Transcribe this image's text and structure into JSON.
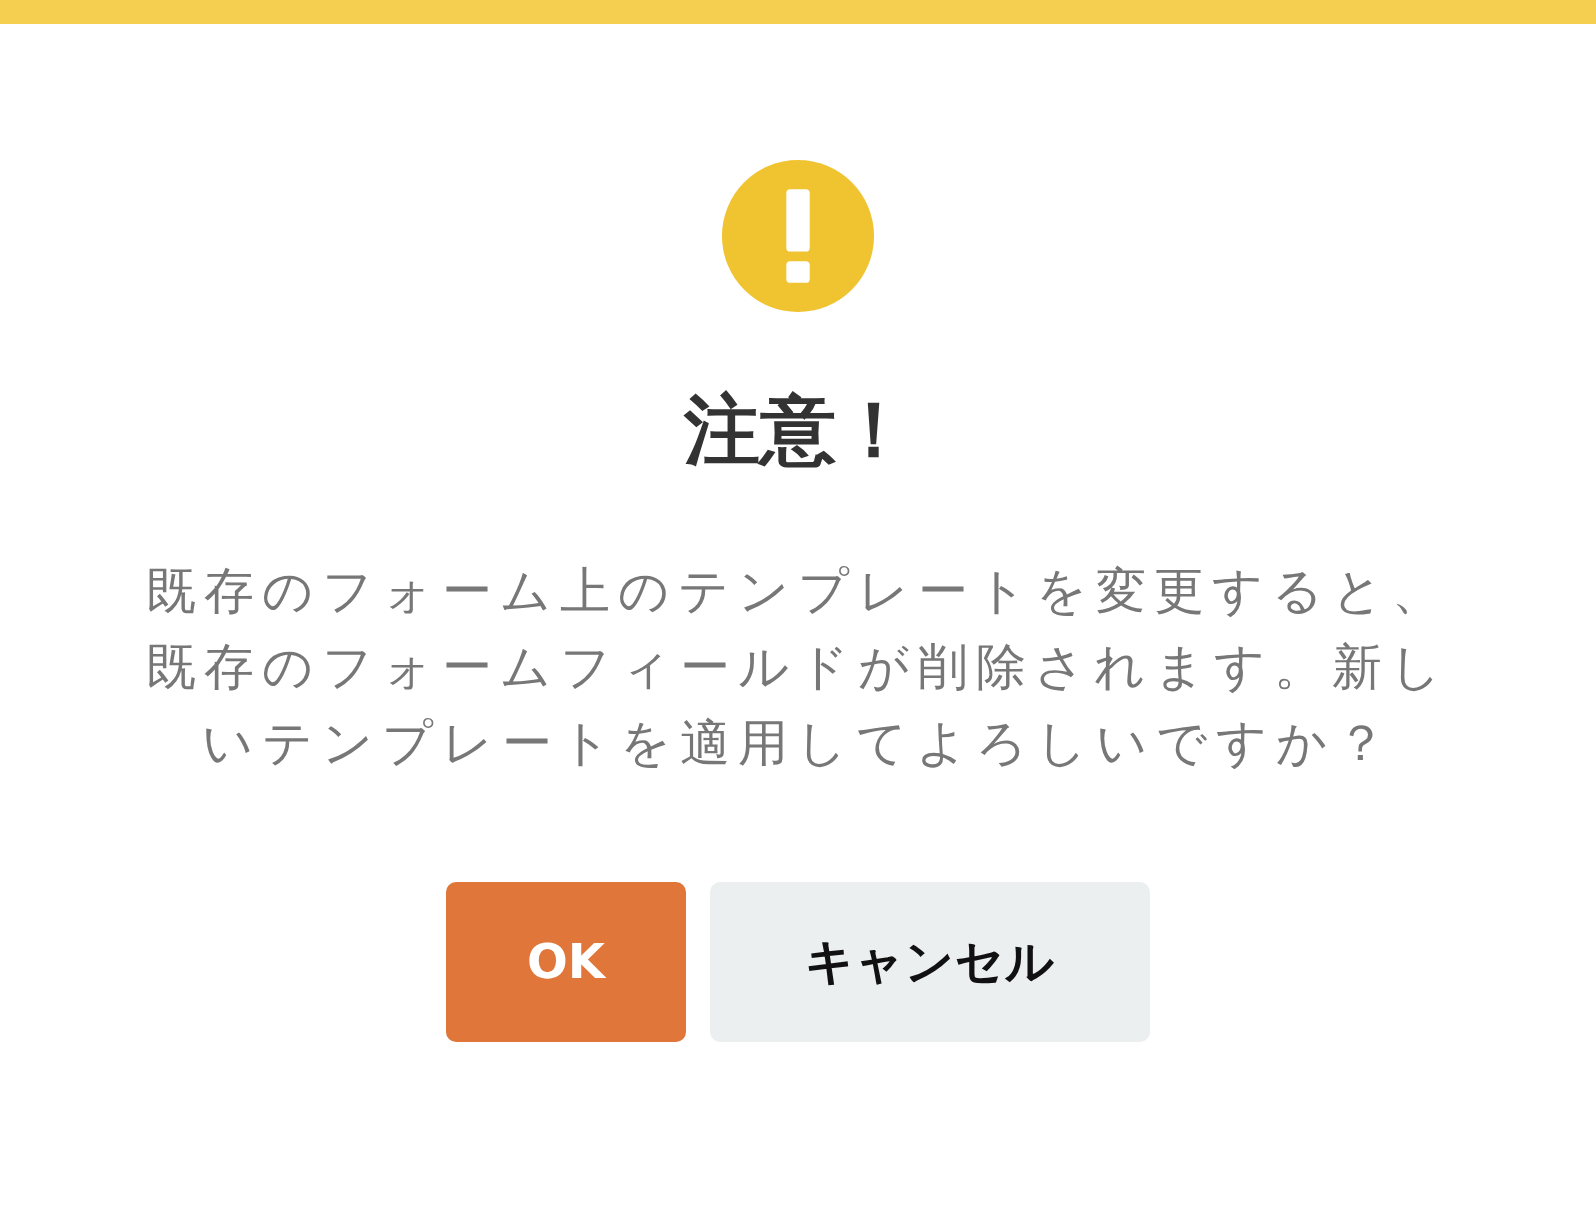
{
  "dialog": {
    "icon": {
      "kind": "warning"
    },
    "title": "注意！",
    "message": "既存のフォーム上のテンプレートを変更すると、既存のフォームフィールドが削除されます。新しいテンプレートを適用してよろしいですか？",
    "buttons": [
      {
        "label": "OK",
        "kind": "primary"
      },
      {
        "label": "キャンセル",
        "kind": "secondary"
      }
    ]
  }
}
